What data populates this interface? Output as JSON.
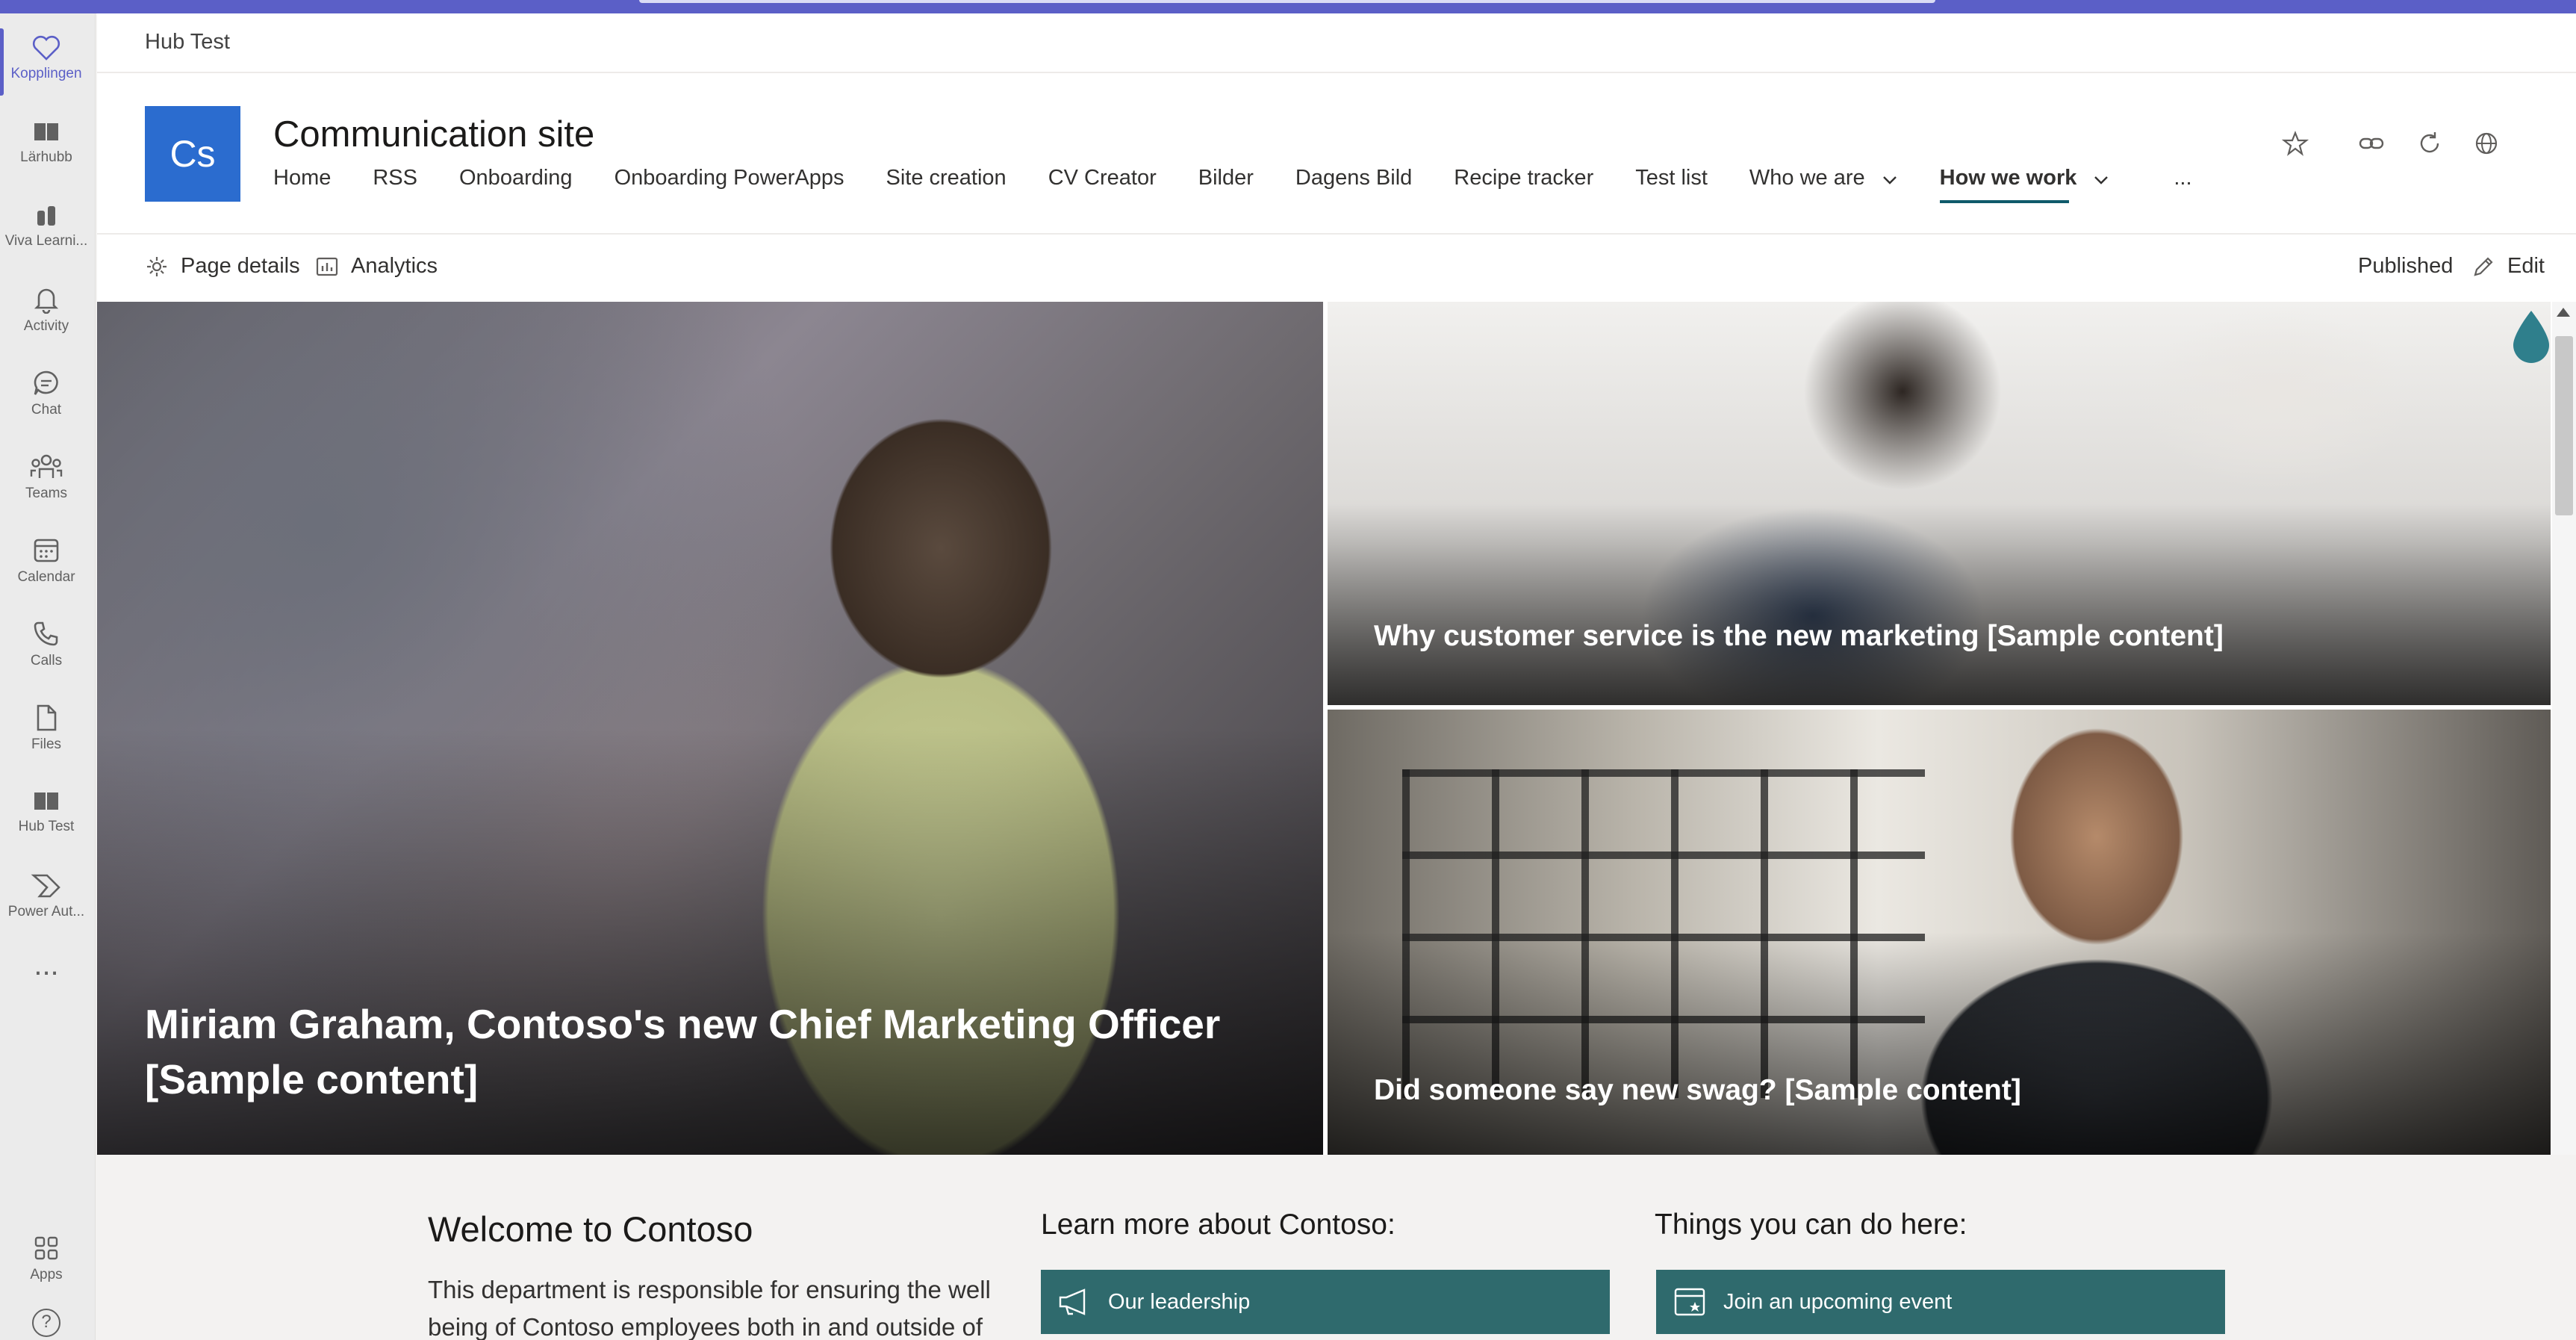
{
  "app": {
    "tab_title": "Hub Test"
  },
  "rail": {
    "items": [
      {
        "label": "Kopplingen",
        "icon": "heart-icon",
        "active": true
      },
      {
        "label": "Lärhubb",
        "icon": "book-icon"
      },
      {
        "label": "Viva Learni...",
        "icon": "learning-icon"
      },
      {
        "label": "Activity",
        "icon": "bell-icon"
      },
      {
        "label": "Chat",
        "icon": "chat-icon"
      },
      {
        "label": "Teams",
        "icon": "teams-icon"
      },
      {
        "label": "Calendar",
        "icon": "calendar-icon"
      },
      {
        "label": "Calls",
        "icon": "phone-icon"
      },
      {
        "label": "Files",
        "icon": "file-icon"
      },
      {
        "label": "Hub Test",
        "icon": "book-icon"
      },
      {
        "label": "Power Aut...",
        "icon": "power-automate-icon"
      }
    ],
    "more_label": "...",
    "apps_label": "Apps",
    "help_label": "?"
  },
  "site": {
    "logo_text": "Cs",
    "logo_color": "#2b6ccf",
    "title": "Communication site",
    "nav": [
      {
        "label": "Home"
      },
      {
        "label": "RSS"
      },
      {
        "label": "Onboarding"
      },
      {
        "label": "Onboarding PowerApps"
      },
      {
        "label": "Site creation"
      },
      {
        "label": "CV Creator"
      },
      {
        "label": "Bilder"
      },
      {
        "label": "Dagens Bild"
      },
      {
        "label": "Recipe tracker"
      },
      {
        "label": "Test list"
      },
      {
        "label": "Who we are",
        "dropdown": true
      },
      {
        "label": "How we work",
        "dropdown": true,
        "selected": true
      }
    ],
    "nav_more": "...",
    "header_icons": [
      "star-icon",
      "link-icon",
      "refresh-icon",
      "globe-icon"
    ]
  },
  "commandbar": {
    "page_details": "Page details",
    "analytics": "Analytics",
    "status": "Published",
    "edit": "Edit"
  },
  "hero": {
    "tiles": [
      {
        "caption_line1": "Miriam Graham, Contoso's new Chief Marketing Officer",
        "caption_line2": "[Sample content]"
      },
      {
        "caption": "Why customer service is the new marketing [Sample content]"
      },
      {
        "caption": "Did someone say new swag? [Sample content]"
      }
    ]
  },
  "welcome": {
    "title": "Welcome to Contoso",
    "body": "This department is responsible for ensuring the well being of Contoso employees both in and outside of"
  },
  "learn_more": {
    "title": "Learn more about Contoso:",
    "link": "Our leadership"
  },
  "things": {
    "title": "Things you can do here:",
    "link": "Join an upcoming event"
  },
  "colors": {
    "teams_purple": "#5b5fc7",
    "accent_teal": "#2f6a6d",
    "nav_underline": "#0f5a6b"
  }
}
